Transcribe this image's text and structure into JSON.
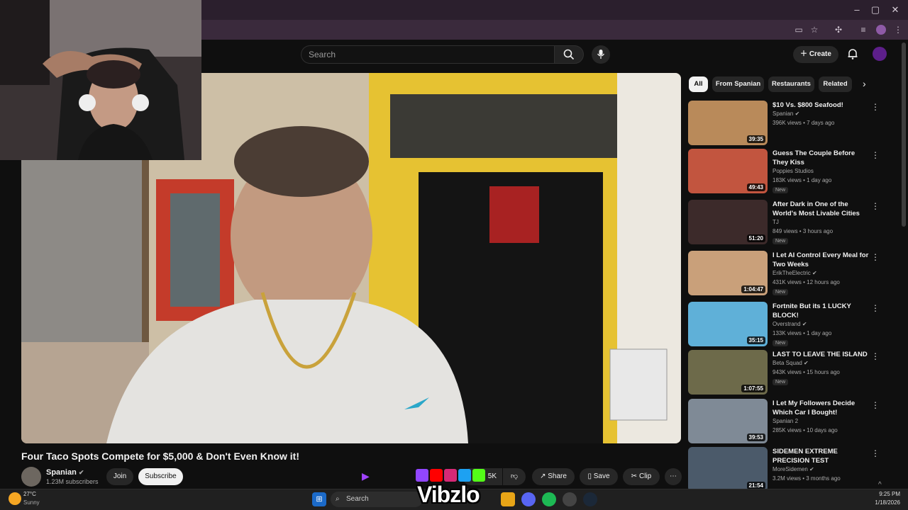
{
  "browser": {
    "window_controls": [
      "–",
      "▢",
      "✕"
    ]
  },
  "header": {
    "search_placeholder": "Search",
    "create_label": "Create"
  },
  "video": {
    "title": "Four Taco Spots Compete for $5,000 & Don't Even Know it!",
    "channel": "Spanian",
    "subscribers": "1.23M subscribers",
    "join_label": "Join",
    "subscribe_label": "Subscribe",
    "likes": "5K",
    "share_label": "Share",
    "save_label": "Save",
    "clip_label": "Clip"
  },
  "chips": [
    "All",
    "From Spanian",
    "Restaurants",
    "Related"
  ],
  "recommendations": [
    {
      "title": "$10 Vs. $800 Seafood!",
      "channel": "Spanian",
      "verified": true,
      "meta": "396K views • 7 days ago",
      "duration": "39:35",
      "new": false,
      "thumb_color": "#b98a5a"
    },
    {
      "title": "Guess The Couple Before They Kiss",
      "channel": "Poppies Studios",
      "verified": false,
      "meta": "183K views • 1 day ago",
      "duration": "49:43",
      "new": true,
      "thumb_color": "#c2553f"
    },
    {
      "title": "After Dark in One of the World's Most Livable Cities",
      "channel": "TJ",
      "verified": false,
      "meta": "849 views • 3 hours ago",
      "duration": "51:20",
      "new": true,
      "thumb_color": "#3c2a2a"
    },
    {
      "title": "I Let AI Control Every Meal for Two Weeks",
      "channel": "ErikTheElectric",
      "verified": true,
      "meta": "431K views • 12 hours ago",
      "duration": "1:04:47",
      "new": true,
      "thumb_color": "#c9a07a"
    },
    {
      "title": "Fortnite But its 1 LUCKY BLOCK!",
      "channel": "Overstrand",
      "verified": true,
      "meta": "133K views • 1 day ago",
      "duration": "35:15",
      "new": true,
      "thumb_color": "#5fb0d8"
    },
    {
      "title": "LAST TO LEAVE THE ISLAND",
      "channel": "Beta Squad",
      "verified": true,
      "meta": "943K views • 15 hours ago",
      "duration": "1:07:55",
      "new": true,
      "thumb_color": "#6d6a4a"
    },
    {
      "title": "I Let My Followers Decide Which Car I Bought!",
      "channel": "Spanian 2",
      "verified": false,
      "meta": "285K views • 10 days ago",
      "duration": "39:53",
      "new": false,
      "thumb_color": "#7f8a96"
    },
    {
      "title": "SIDEMEN EXTREME PRECISION TEST",
      "channel": "MoreSidemen",
      "verified": true,
      "meta": "3.2M views • 3 months ago",
      "duration": "21:54",
      "new": false,
      "thumb_color": "#4b5a6a"
    }
  ],
  "taskbar": {
    "weather_temp": "27°C",
    "weather_desc": "Sunny",
    "search_label": "Search",
    "time": "9:25 PM",
    "date": "1/18/2026"
  },
  "overlay": {
    "watermark": "Vibzlo"
  }
}
